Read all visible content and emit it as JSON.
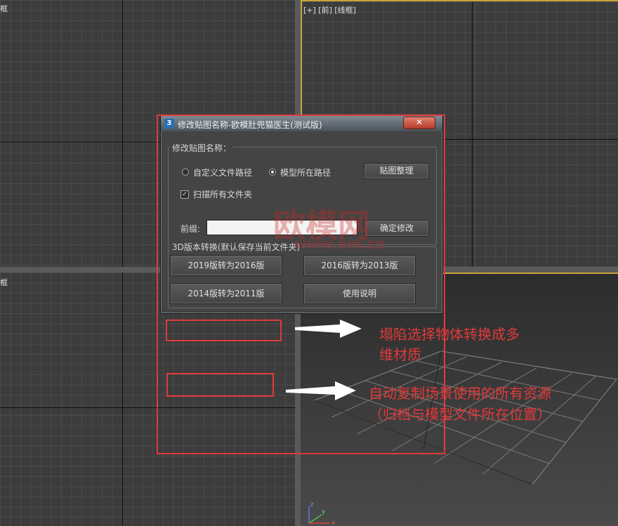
{
  "viewports": {
    "top_left_label": "框",
    "top_right_label": "[+] [前] [线框]",
    "bottom_left_label": "框"
  },
  "dialog": {
    "title": "修改贴图名称-欧模肚兜猫医生(测试版)",
    "close_label": "✕",
    "rename_group": {
      "label": "修改贴图名称：",
      "radio_custom_label": "自定义文件路径",
      "radio_model_label": "模型所在路径",
      "radio_selected": "模型所在路径",
      "texture_organize_button": "贴图整理",
      "scan_all_folders_label": "扫描所有文件夹",
      "scan_all_folders_checked": true,
      "prefix_label": "前缀:",
      "prefix_value": "",
      "confirm_button": "确定修改"
    },
    "version_group": {
      "label": "3D版本转换(默认保存当前文件夹)",
      "btn_2019_to_2016": "2019版转为2016版",
      "btn_2016_to_2013": "2016版转为2013版",
      "btn_2014_to_2011": "2014版转为2011版",
      "btn_help": "使用说明"
    }
  },
  "watermark": {
    "brand": "欧模网",
    "url": "www.om.cn"
  },
  "annotations": {
    "note1_line1": "塌陷选择物体转换成多",
    "note1_line2": "维材质",
    "note2_line1": "自动复制场景使用的所有资源",
    "note2_line2": "（归档与模型文件所在位置）",
    "color": "#e03a3a"
  },
  "axis_labels": {
    "z": "z",
    "y": "y",
    "x": "x"
  }
}
